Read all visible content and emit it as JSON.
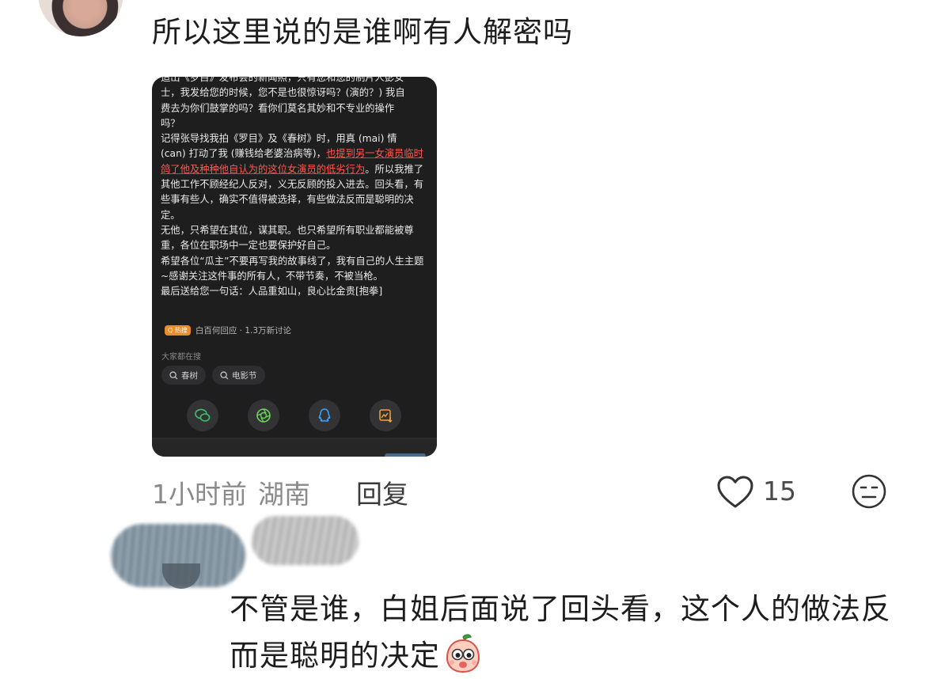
{
  "comment1": {
    "text": "所以这里说的是谁啊有人解密吗",
    "screenshot": {
      "lines": [
        "造出《罗目》发布会的新闻照，只有您和您的制片人彭女",
        "士，我发给您的时候，您不是也很惊讶吗？(演的？) 我自",
        "费去为你们鼓掌的吗？看你们莫名其妙和不专业的操作",
        "吗？",
        "记得张导找我拍《罗目》及《春树》时，用真 (mai) 情",
        "(can) 打动了我 (赚钱给老婆治病等)，"
      ],
      "highlight_1": "也提到另一女演员",
      "highlight_2": "临时鸽了他及种种他自认为的这位女演员的低劣行为",
      "after_highlight": "。所以我推了其他工作不顾经纪人反对，义无反顾的投入进去。回头看，有些事有些人，确实不值得被选择，有些做法反而是聪明的决定。",
      "para2": "无他，只希望在其位，谋其职。也只希望所有职业都能被尊重，各位在职场中一定也要保护好自己。",
      "para3": "希望各位“瓜主”不要再写我的故事线了，我有自己的人生主题~感谢关注这件事的所有人，不带节奏，不被当枪。",
      "para4": "最后送给您一句话：人品重如山，良心比金贵[抱拳]",
      "topic_badge": "Q 热搜",
      "topic_text": "白百何回应 · 1.3万新讨论",
      "hot_label": "大家都在搜",
      "chips": [
        "春树",
        "电影节"
      ],
      "share_icons": [
        "wechat-icon",
        "moments-icon",
        "qq-icon",
        "save-image-icon"
      ]
    },
    "time": "1小时前",
    "location": "湖南",
    "reply_label": "回复",
    "like_count": "15"
  },
  "comment2": {
    "text": "不管是谁，白姐后面说了回头看，这个人的做法反而是聪明的决定",
    "emoji": "peach-emoji"
  }
}
